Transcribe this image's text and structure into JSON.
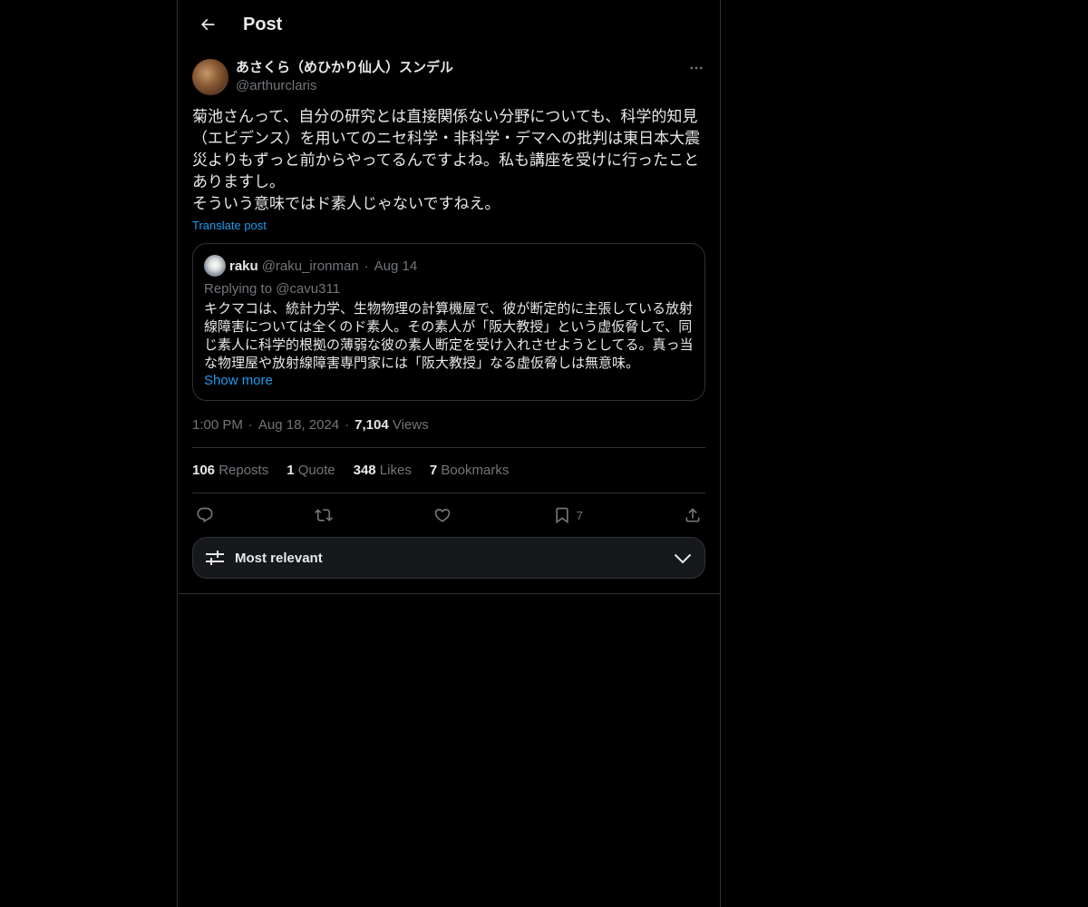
{
  "header": {
    "title": "Post"
  },
  "author": {
    "name": "あさくら（めひかり仙人）スンデル",
    "handle": "@arthurclaris"
  },
  "post": {
    "text": "菊池さんって、自分の研究とは直接関係ない分野についても、科学的知見（エビデンス）を用いてのニセ科学・非科学・デマへの批判は東日本大震災よりもずっと前からやってるんですよね。私も講座を受けに行ったことありますし。\nそういう意味ではド素人じゃないですねえ。",
    "translate_label": "Translate post"
  },
  "quote": {
    "name": "raku",
    "handle": "@raku_ironman",
    "dot": "·",
    "date": "Aug 14",
    "replying_prefix": "Replying to ",
    "replying_handle": "@cavu311",
    "text": "キクマコは、統計力学、生物物理の計算機屋で、彼が断定的に主張している放射線障害については全くのド素人。その素人が「阪大教授」という虚仮脅しで、同じ素人に科学的根拠の薄弱な彼の素人断定を受け入れさせようとしてる。真っ当な物理屋や放射線障害専門家には「阪大教授」なる虚仮脅しは無意味。",
    "show_more": "Show more"
  },
  "meta": {
    "time": "1:00 PM",
    "sep1": "·",
    "date": "Aug 18, 2024",
    "sep2": "·",
    "views_count": "7,104",
    "views_label": " Views"
  },
  "stats": {
    "reposts_count": "106",
    "reposts_label": " Reposts",
    "quotes_count": "1",
    "quotes_label": " Quote",
    "likes_count": "348",
    "likes_label": " Likes",
    "bookmarks_count": "7",
    "bookmarks_label": " Bookmarks"
  },
  "actions": {
    "bookmark_count": "7"
  },
  "sort": {
    "label": "Most relevant"
  },
  "icons": {
    "back": "arrow-left-icon",
    "more": "more-dots-icon",
    "reply": "reply-icon",
    "repost": "repost-icon",
    "like": "heart-icon",
    "bookmark": "bookmark-icon",
    "share": "share-icon",
    "sort": "sliders-icon",
    "chevron": "chevron-down-icon"
  },
  "colors": {
    "background": "#000000",
    "text": "#e7e9ea",
    "muted": "#71767b",
    "accent": "#1d9bf0",
    "border": "#2f3336"
  }
}
